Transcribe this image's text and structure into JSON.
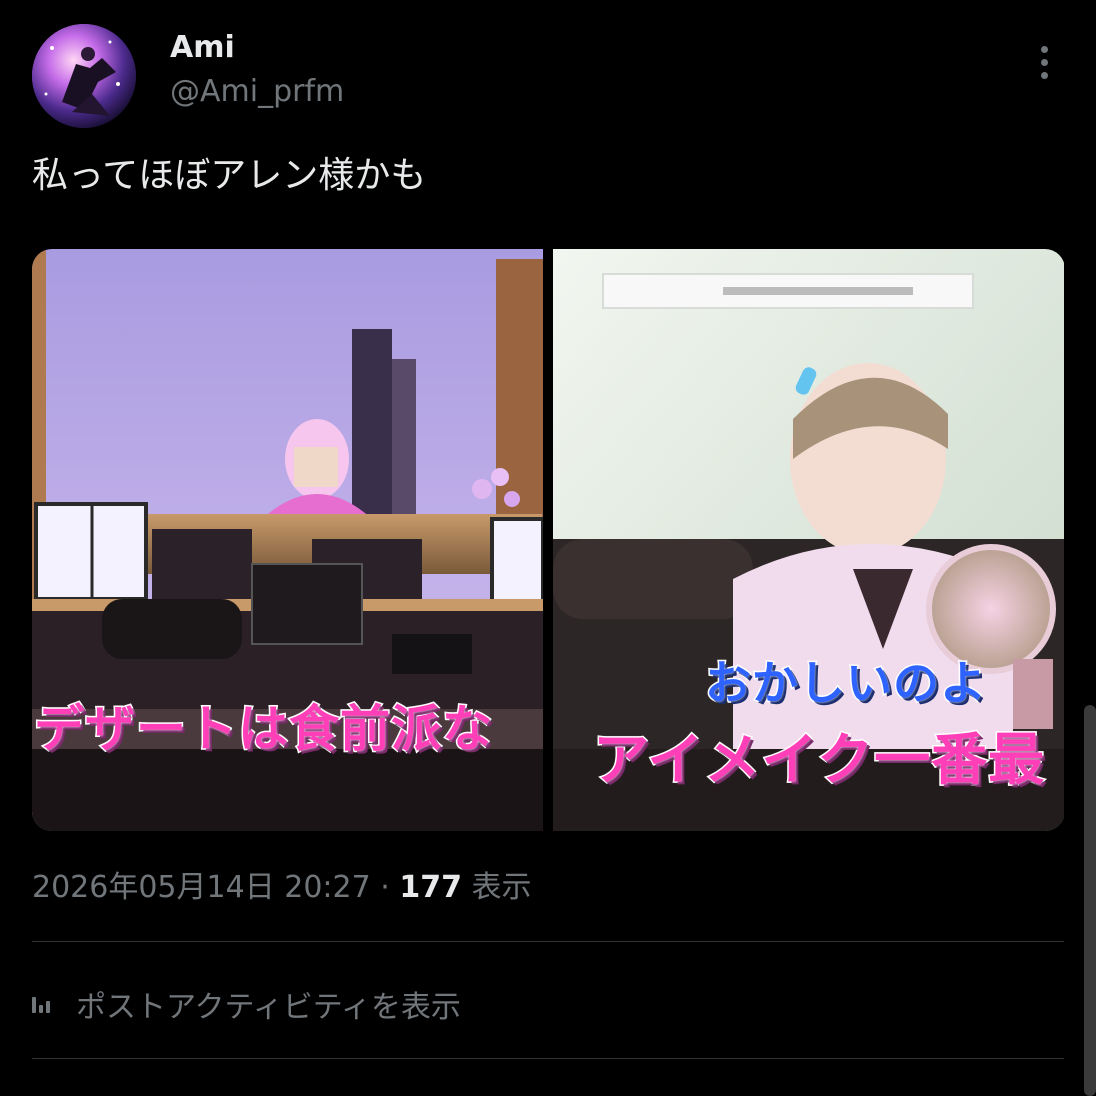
{
  "author": {
    "name": "Ami",
    "handle": "@Ami_prfm"
  },
  "tweet": {
    "text": "私ってほぼアレン様かも"
  },
  "media": [
    {
      "caption": "デザートは食前派な"
    },
    {
      "caption_top": "おかしいのよ",
      "caption_bottom": "アイメイク一番最"
    }
  ],
  "meta": {
    "datetime": "2026年05月14日 20:27",
    "separator": "·",
    "views_count": "177",
    "views_label": "表示"
  },
  "activity": {
    "label": "ポストアクティビティを表示",
    "icon": "bar-chart-icon"
  },
  "icons": {
    "more": "more-vertical-icon"
  },
  "colors": {
    "background": "#000000",
    "text_primary": "#e7e9ea",
    "text_secondary": "#71767b",
    "divider": "#2f3336",
    "caption_pink": "#ff3fb8",
    "caption_blue": "#2f63ff"
  }
}
